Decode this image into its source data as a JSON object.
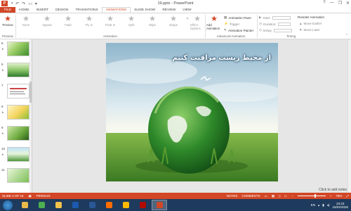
{
  "window": {
    "title": "19.pptx - PowerPoint",
    "app_icon": "P",
    "controls": [
      "?",
      "—",
      "❐",
      "✕"
    ]
  },
  "tabs": [
    "FILE",
    "HOME",
    "INSERT",
    "DESIGN",
    "TRANSITIONS",
    "ANIMATIONS",
    "SLIDE SHOW",
    "REVIEW",
    "VIEW"
  ],
  "active_tab": "ANIMATIONS",
  "ribbon": {
    "preview_label": "Preview",
    "effects": [
      "None",
      "Appear",
      "Fade",
      "Fly In",
      "Float In",
      "Split",
      "Wipe",
      "Shape"
    ],
    "effect_options_label": "Effect Options",
    "add_animation_label": "Add Animation",
    "animation_pane_label": "Animation Pane",
    "trigger_label": "Trigger",
    "animation_painter_label": "Animation Painter",
    "start_label": "Start:",
    "duration_label": "Duration:",
    "delay_label": "Delay:",
    "reorder_title": "Reorder Animation",
    "move_earlier_label": "Move Earlier",
    "move_later_label": "Move Later",
    "groups": {
      "preview": "Preview",
      "animation": "Animation",
      "advanced": "Advanced Animation",
      "timing": "Timing"
    }
  },
  "thumbnails": [
    {
      "num": "5",
      "star": "★"
    },
    {
      "num": "6",
      "star": "★"
    },
    {
      "num": "7",
      "star": ""
    },
    {
      "num": "8",
      "star": "★"
    },
    {
      "num": "9",
      "star": "★"
    },
    {
      "num": "10",
      "star": "★"
    },
    {
      "num": "11",
      "star": ""
    }
  ],
  "slide": {
    "title": "از محیط زیست مراقبت کنیم"
  },
  "notes_placeholder": "Click to add notes",
  "statusbar": {
    "slide_counter": "SLIDE 2 OF 16",
    "language": "PERSIAN",
    "notes": "NOTES",
    "comments": "COMMENTS",
    "zoom": "78%",
    "zoom_fraction": 0.62
  },
  "taskbar": {
    "apps": [
      {
        "name": "explorer-app",
        "color": "#e9b94a"
      },
      {
        "name": "chrome-app",
        "color": "#4caf50"
      },
      {
        "name": "files-app",
        "color": "#f2c34c"
      },
      {
        "name": "media-app",
        "color": "#1c5ab0"
      },
      {
        "name": "word-app",
        "color": "#2b5797"
      },
      {
        "name": "firefox-app",
        "color": "#ff6d00"
      },
      {
        "name": "folder-app",
        "color": "#ffb900"
      },
      {
        "name": "acrobat-app",
        "color": "#b30b00"
      },
      {
        "name": "powerpoint-app",
        "color": "#d24726"
      }
    ],
    "lang": "EN",
    "time": "23:23",
    "date": "15/02/2020"
  },
  "colors": {
    "accent": "#d24726",
    "taskbar": "#1e3a5c"
  }
}
